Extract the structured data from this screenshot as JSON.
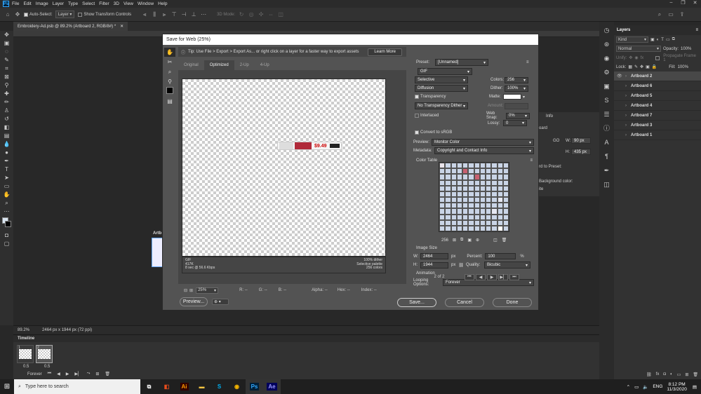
{
  "menubar": {
    "logo": "Ps",
    "items": [
      "File",
      "Edit",
      "Image",
      "Layer",
      "Type",
      "Select",
      "Filter",
      "3D",
      "View",
      "Window",
      "Help"
    ],
    "window_controls": [
      "–",
      "❐",
      "✕"
    ]
  },
  "options": {
    "auto_select_label": "Auto-Select:",
    "auto_select_value": "Layer",
    "show_transform_label": "Show Transform Controls",
    "mode_3d": "3D Mode:"
  },
  "document": {
    "tab_title": "Embroidery-Ad.psb @ 89.2% (Artboard 2, RGB/8#) *",
    "close": "✕",
    "artboard_label": "Artb"
  },
  "status": {
    "zoom": "89.2%",
    "dimensions": "2464 px x 1944 px (72 ppi)"
  },
  "timeline": {
    "title": "Timeline",
    "frames": [
      {
        "num": "1",
        "delay": "0.5"
      },
      {
        "num": "2",
        "delay": "0.5"
      }
    ],
    "loop": "Forever"
  },
  "layers_panel": {
    "title": "Layers",
    "kind": "Kind",
    "blend": "Normal",
    "opacity_label": "Opacity:",
    "opacity": "100%",
    "unify_label": "Unify:",
    "propagate_label": "Propagate Frame 1",
    "lock_label": "Lock:",
    "fill_label": "Fill:",
    "fill": "100%",
    "layers": [
      "Artboard 2",
      "Artboard 6",
      "Artboard 5",
      "Artboard 4",
      "Artboard 7",
      "Artboard 3",
      "Artboard 1"
    ]
  },
  "info_panel": {
    "title": "Info",
    "w_label": "W:",
    "w": "90 px",
    "h_label": "H:",
    "h": "435 px",
    "go_label": "GO",
    "artboard_text": "oard",
    "to_preset": "rd to Preset:",
    "bg_color": "Background color:",
    "white": "ite"
  },
  "dialog": {
    "title": "Save for Web (25%)",
    "tip": "Tip: Use File > Export > Export As...  or right click on a layer for a faster way to export assets",
    "learn_more": "Learn More",
    "tabs": [
      "Original",
      "Optimized",
      "2-Up",
      "4-Up"
    ],
    "banner_price": "$9.49",
    "info_left": [
      "GIF",
      "417K",
      "8 sec @ 56.6 Kbps"
    ],
    "info_right": [
      "100% dither",
      "Selective palette",
      "256 colors"
    ],
    "zoom": "25%",
    "readouts": [
      "R: --",
      "G: --",
      "B: --",
      "Alpha: --",
      "Hex: --",
      "Index: --"
    ],
    "preview_btn": "Preview...",
    "save_btn": "Save...",
    "cancel_btn": "Cancel",
    "done_btn": "Done",
    "settings": {
      "preset_label": "Preset:",
      "preset": "[Unnamed]",
      "format": "GIF",
      "reduction": "Selective",
      "dither_algo": "Diffusion",
      "colors_label": "Colors:",
      "colors": "256",
      "dither_label": "Dither:",
      "dither": "100%",
      "transparency_label": "Transparency",
      "matte_label": "Matte:",
      "transparency_dither": "No Transparency Dither",
      "amount_label": "Amount:",
      "interlaced_label": "Interlaced",
      "websnap_label": "Web Snap:",
      "websnap": "0%",
      "lossy_label": "Lossy:",
      "lossy": "0",
      "srgb_label": "Convert to sRGB",
      "preview_label": "Preview:",
      "preview_value": "Monitor Color",
      "metadata_label": "Metadata:",
      "metadata_value": "Copyright and Contact Info",
      "color_table_label": "Color Table",
      "color_count": "256",
      "image_size_label": "Image Size",
      "w_label": "W:",
      "w": "2464",
      "h_label": "H:",
      "h": "1944",
      "px": "px",
      "percent_label": "Percent:",
      "percent": "100",
      "percent_unit": "%",
      "quality_label": "Quality:",
      "quality": "Bicubic",
      "animation_label": "Animation",
      "looping_label": "Looping Options:",
      "looping": "Forever",
      "frame_counter": "2 of 2"
    }
  },
  "taskbar": {
    "search_placeholder": "Type here to search",
    "apps": [
      "Ai",
      "Ps",
      "Ae"
    ],
    "lang": "ENG",
    "time": "8:12 PM",
    "date": "11/3/2020"
  },
  "colors": {
    "ps_blue": "#31a8ff",
    "ae_purple": "#9999ff",
    "ai_orange": "#ff9a00"
  }
}
